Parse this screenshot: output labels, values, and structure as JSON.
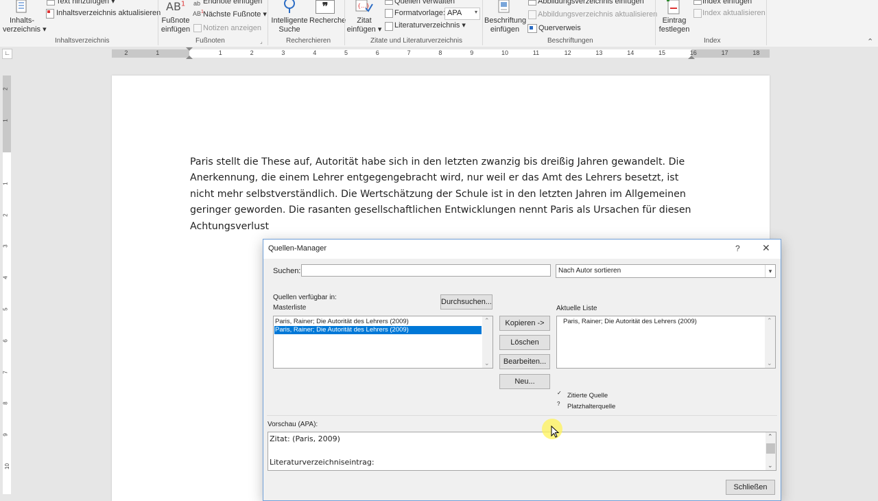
{
  "ribbon": {
    "toc_group": {
      "toc_button": "Inhalts-\nverzeichnis",
      "toc_line1": "Inhalts-",
      "toc_line2": "verzeichnis ▾",
      "add_text": "Text hinzufügen ▾",
      "update_toc": "Inhaltsverzeichnis aktualisieren",
      "label": "Inhaltsverzeichnis"
    },
    "footnotes_group": {
      "insert_footnote_line1": "Fußnote",
      "insert_footnote_line2": "einfügen",
      "insert_endnote": "Endnote einfügen",
      "next_footnote": "Nächste Fußnote ▾",
      "show_notes": "Notizen anzeigen",
      "label": "Fußnoten"
    },
    "research_group": {
      "smart_lookup_line1": "Intelligente",
      "smart_lookup_line2": "Suche",
      "researcher": "Recherche",
      "label": "Recherchieren"
    },
    "citations_group": {
      "insert_citation_line1": "Zitat",
      "insert_citation_line2": "einfügen ▾",
      "manage_sources": "Quellen verwalten",
      "style_label": "Formatvorlage:",
      "style_value": "APA",
      "bibliography": "Literaturverzeichnis ▾",
      "label": "Zitate und Literaturverzeichnis"
    },
    "captions_group": {
      "insert_caption_line1": "Beschriftung",
      "insert_caption_line2": "einfügen",
      "insert_table_of_figures": "Abbildungsverzeichnis einfügen",
      "update_table": "Abbildungsverzeichnis aktualisieren",
      "cross_reference": "Querverweis",
      "label": "Beschriftungen"
    },
    "index_group": {
      "mark_entry_line1": "Eintrag",
      "mark_entry_line2": "festlegen",
      "insert_index": "Index einfügen",
      "update_index": "Index aktualisieren",
      "label": "Index"
    }
  },
  "ruler": {
    "labels": [
      "2",
      "1",
      "1",
      "2",
      "3",
      "4",
      "5",
      "6",
      "7",
      "8",
      "9",
      "10",
      "11",
      "12",
      "13",
      "14",
      "15",
      "16",
      "17",
      "18"
    ]
  },
  "vruler": {
    "labels": [
      "2",
      "1",
      "1",
      "2",
      "3",
      "4",
      "5",
      "6",
      "7",
      "8",
      "9",
      "10"
    ]
  },
  "document": {
    "paragraph": "Paris stellt die These auf, Autorität habe sich in den letzten zwanzig bis dreißig Jahren gewandelt. Die Anerkennung, die einem Lehrer entgegengebracht wird, nur weil er das Amt des Lehrers besetzt, ist nicht mehr selbstverständlich. Die Wertschätzung der Schule ist in den letzten Jahren im Allgemeinen geringer geworden. Die rasanten gesellschaftlichen Entwicklungen nennt Paris als Ursachen für diesen Achtungsverlust"
  },
  "dialog": {
    "title": "Quellen-Manager",
    "help": "?",
    "close": "✕",
    "search_label": "Suchen:",
    "search_value": "",
    "sort_value": "Nach Autor sortieren",
    "sources_available": "Quellen verfügbar in:",
    "master_list_label": "Masterliste",
    "browse_button": "Durchsuchen...",
    "current_list_label": "Aktuelle Liste",
    "master_items": [
      "Paris, Rainer; Die Autorität des Lehrers (2009)",
      "Paris, Rainer; Die Autorität des Lehrers (2009)"
    ],
    "current_items": [
      "Paris, Rainer; Die Autorität des Lehrers (2009)"
    ],
    "buttons": {
      "copy": "Kopieren ->",
      "delete": "Löschen",
      "edit": "Bearbeiten...",
      "new": "Neu..."
    },
    "legend": {
      "cited_mark": "✓",
      "cited": "Zitierte Quelle",
      "placeholder_mark": "?",
      "placeholder": "Platzhalterquelle"
    },
    "preview_label": "Vorschau (APA):",
    "preview_citation": "Zitat:  (Paris, 2009)",
    "preview_bib_label": "Literaturverzeichniseintrag:",
    "close_button": "Schließen"
  },
  "colors": {
    "selection": "#0078d7",
    "dialog_border": "#6f9fd8",
    "cursor_highlight": "#fff35a"
  }
}
